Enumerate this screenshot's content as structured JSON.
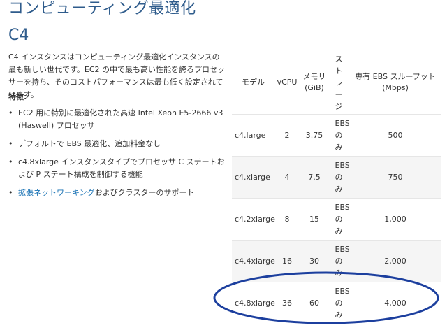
{
  "heading": "コンピューティング最適化",
  "subheading": "C4",
  "intro": "C4 インスタンスはコンピューティング最適化インスタンスの最も新しい世代です。EC2 の中で最も高い性能を誇るプロセッサーを持ち、そのコストパフォーマンスは最も低く設定されています。",
  "features_label": "特徴:",
  "features": [
    {
      "text": "EC2 用に特別に最適化された高速 Intel Xeon E5-2666 v3 (Haswell) プロセッサ"
    },
    {
      "text": "デフォルトで EBS 最適化、追加料金なし"
    },
    {
      "text": "c4.8xlarge インスタンスタイプでプロセッサ C ステートおよび P ステート構成を制御する機能"
    },
    {
      "link": "拡張ネットワーキング",
      "text": "およびクラスターのサポート"
    }
  ],
  "table": {
    "headers": {
      "model": "モデル",
      "vcpu": "vCPU",
      "memory": "メモリ (GiB)",
      "storage": "ストレージ",
      "ebs_throughput": "専有 EBS スループット (Mbps)"
    },
    "rows": [
      {
        "model": "c4.large",
        "vcpu": "2",
        "memory": "3.75",
        "storage": "EBS のみ",
        "ebs": "500"
      },
      {
        "model": "c4.xlarge",
        "vcpu": "4",
        "memory": "7.5",
        "storage": "EBS のみ",
        "ebs": "750"
      },
      {
        "model": "c4.2xlarge",
        "vcpu": "8",
        "memory": "15",
        "storage": "EBS のみ",
        "ebs": "1,000"
      },
      {
        "model": "c4.4xlarge",
        "vcpu": "16",
        "memory": "30",
        "storage": "EBS のみ",
        "ebs": "2,000"
      },
      {
        "model": "c4.8xlarge",
        "vcpu": "36",
        "memory": "60",
        "storage": "EBS のみ",
        "ebs": "4,000"
      }
    ]
  },
  "colors": {
    "heading": "#2f5c8c",
    "link": "#1a73b5",
    "highlight": "#1c3f9e"
  }
}
